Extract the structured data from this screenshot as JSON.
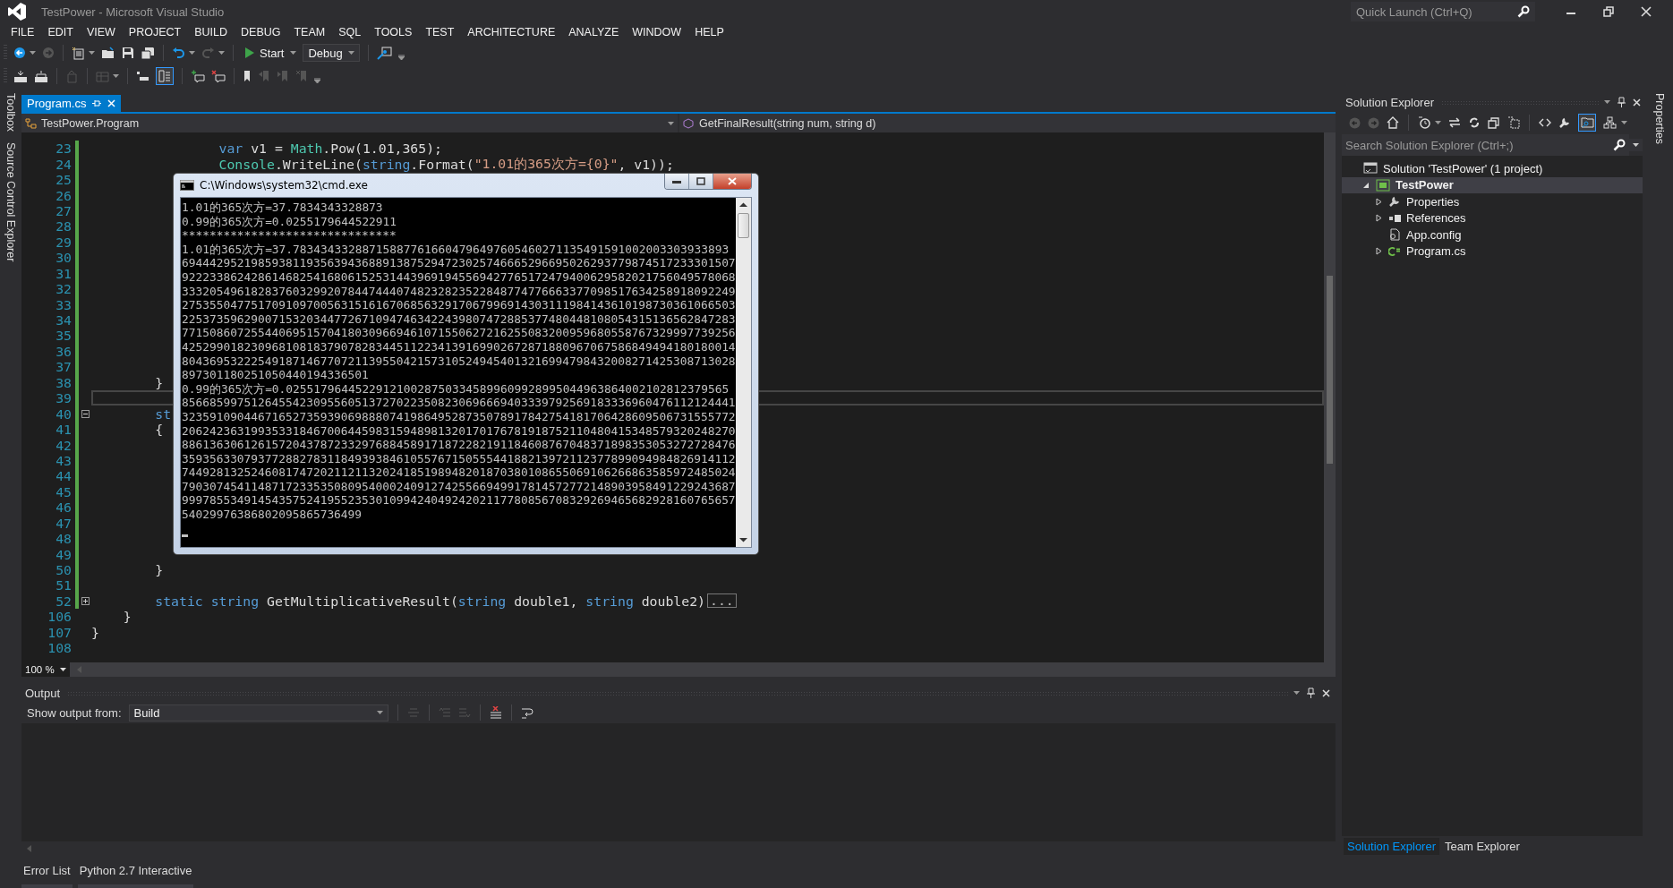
{
  "window": {
    "title": "TestPower - Microsoft Visual Studio",
    "quick_launch": {
      "placeholder": "Quick Launch (Ctrl+Q)"
    }
  },
  "menu": [
    "FILE",
    "EDIT",
    "VIEW",
    "PROJECT",
    "BUILD",
    "DEBUG",
    "TEAM",
    "SQL",
    "TOOLS",
    "TEST",
    "ARCHITECTURE",
    "ANALYZE",
    "WINDOW",
    "HELP"
  ],
  "toolbar": {
    "start_label": "Start",
    "configuration": "Debug",
    "toggle_on": true
  },
  "left_tabs": [
    "Toolbox",
    "Source Control Explorer"
  ],
  "document_tabs": [
    {
      "label": "Program.cs",
      "selected": true
    }
  ],
  "navigation": {
    "class": "TestPower.Program",
    "member": "GetFinalResult(string num, string d)"
  },
  "code_lines": [
    {
      "number": "23",
      "changed": true,
      "current": false,
      "tokens": [
        {
          "kind": "keyword",
          "text": "                var"
        },
        {
          "kind": "plain",
          "text": " v1 = "
        },
        {
          "kind": "type",
          "text": "Math"
        },
        {
          "kind": "plain",
          "text": ".Pow(1.01,365);"
        }
      ]
    },
    {
      "number": "24",
      "changed": true,
      "current": false,
      "tokens": [
        {
          "kind": "type",
          "text": "                Console"
        },
        {
          "kind": "plain",
          "text": ".WriteLine("
        },
        {
          "kind": "keyword",
          "text": "string"
        },
        {
          "kind": "plain",
          "text": ".Format("
        },
        {
          "kind": "string",
          "text": "\"1.01的365次方={0}\""
        },
        {
          "kind": "plain",
          "text": ", v1));"
        }
      ]
    },
    {
      "number": "25",
      "changed": true,
      "current": false
    },
    {
      "number": "26",
      "changed": true,
      "current": false
    },
    {
      "number": "27",
      "changed": true,
      "current": false
    },
    {
      "number": "28",
      "changed": true,
      "current": false
    },
    {
      "number": "29",
      "changed": true,
      "current": false
    },
    {
      "number": "30",
      "changed": true,
      "current": false
    },
    {
      "number": "31",
      "changed": true,
      "current": false
    },
    {
      "number": "32",
      "changed": true,
      "current": false
    },
    {
      "number": "33",
      "changed": true,
      "current": false
    },
    {
      "number": "34",
      "changed": true,
      "current": false
    },
    {
      "number": "35",
      "changed": true,
      "current": false
    },
    {
      "number": "36",
      "changed": true,
      "current": false
    },
    {
      "number": "37",
      "changed": true,
      "current": false
    },
    {
      "number": "38",
      "changed": true,
      "current": false,
      "tokens": [
        {
          "kind": "plain",
          "text": "        }"
        }
      ]
    },
    {
      "number": "39",
      "changed": true,
      "current": true
    },
    {
      "number": "40",
      "changed": true,
      "current": false,
      "folded": false,
      "tokens": [
        {
          "kind": "keyword",
          "text": "        st"
        }
      ]
    },
    {
      "number": "41",
      "changed": true,
      "current": false,
      "tokens": [
        {
          "kind": "plain",
          "text": "        {"
        }
      ]
    },
    {
      "number": "42",
      "changed": true,
      "current": false
    },
    {
      "number": "43",
      "changed": true,
      "current": false
    },
    {
      "number": "44",
      "changed": true,
      "current": false
    },
    {
      "number": "45",
      "changed": true,
      "current": false
    },
    {
      "number": "46",
      "changed": true,
      "current": false
    },
    {
      "number": "47",
      "changed": true,
      "current": false
    },
    {
      "number": "48",
      "changed": true,
      "current": false
    },
    {
      "number": "49",
      "changed": true,
      "current": false
    },
    {
      "number": "50",
      "changed": true,
      "current": false,
      "tokens": [
        {
          "kind": "plain",
          "text": "        }"
        }
      ]
    },
    {
      "number": "51",
      "changed": true,
      "current": false
    },
    {
      "number": "52",
      "changed": true,
      "current": false,
      "folded": true,
      "collapsed_text": "...",
      "tokens": [
        {
          "kind": "keyword",
          "text": "        static"
        },
        {
          "kind": "keyword",
          "text": " string"
        },
        {
          "kind": "plain",
          "text": " GetMultiplicativeResult("
        },
        {
          "kind": "keyword",
          "text": "string"
        },
        {
          "kind": "plain",
          "text": " double1, "
        },
        {
          "kind": "keyword",
          "text": "string"
        },
        {
          "kind": "plain",
          "text": " double2)"
        }
      ]
    },
    {
      "number": "106",
      "changed": false,
      "current": false,
      "tokens": [
        {
          "kind": "plain",
          "text": "    }"
        }
      ]
    },
    {
      "number": "107",
      "changed": false,
      "current": false,
      "tokens": [
        {
          "kind": "plain",
          "text": "}"
        }
      ]
    },
    {
      "number": "108",
      "changed": false,
      "current": false
    }
  ],
  "zoom": "100 %",
  "console": {
    "title": "C:\\Windows\\system32\\cmd.exe",
    "lines": [
      "1.01的365次方=37.7834343328873",
      "0.99的365次方=0.0255179644522911",
      "*******************************",
      "1.01的365次方=37.783434332887158877616604796497605460271135491591002003303933893",
      "69444295219859381193563943688913875294723025746665296695026293779874517233301507",
      "92223386242861468254168061525314439691945569427765172479400629582021756049578068",
      "33320549618283760329920784474440748232823522848774776663377098517634258918092249",
      "27535504775170910970056315161670685632917067996914303111984143610198730361066503",
      "22537359629007153203447726710947463422439807472885377480448108054315136562847283",
      "77150860725544069515704180309669461071550627216255083200959680558767329997739256",
      "42529901823096810818379078283445112234139169902672871880967067586849494180180014",
      "80436953222549187146770721139550421573105249454013216994798432008271425308713028",
      "897301180251050440194336501",
      "0.99的365次方=0.0255179644522912100287503345899609928995044963864002102812379565",
      "85668599751264554230955605137270223508230696669403339792569183336960476112124441",
      "32359109044671652735939069888074198649528735078917842754181706428609506731555772",
      "20624236319935331846700644598315948981320170176781918752110480415348579320248270",
      "88613630612615720437872332976884589171872282191184608767048371898353053272728476",
      "35935633079377288278311849393846105576715055544188213972112377899094984826914112",
      "74492813252460817472021121132024185198948201870380108655069106266863585972485024",
      "79030745411487172335350809540002409127425566949917814572772148903958491229243687",
      "99978553491454357524195523530109942404924202117780856708329269465682928160765657",
      "54029976386802095865736499"
    ]
  },
  "output": {
    "title": "Output",
    "show_from_label": "Show output from:",
    "source": "Build"
  },
  "bottom_tabs": [
    {
      "label": "Error List",
      "selected": false
    },
    {
      "label": "Python 2.7 Interactive",
      "selected": false
    }
  ],
  "solution_explorer": {
    "title": "Solution Explorer",
    "toggle_on": true,
    "search": {
      "placeholder": "Search Solution Explorer (Ctrl+;)"
    },
    "tree": [
      {
        "label": "Solution 'TestPower' (1 project)",
        "kind": "solution",
        "selected": false,
        "children": [
          {
            "label": "TestPower",
            "kind": "project",
            "expanded": true,
            "selected": true,
            "children": [
              {
                "label": "Properties",
                "kind": "properties",
                "expanded": false,
                "selected": false
              },
              {
                "label": "References",
                "kind": "references",
                "expanded": false,
                "selected": false
              },
              {
                "label": "App.config",
                "kind": "config",
                "selected": false
              },
              {
                "label": "Program.cs",
                "kind": "csharp",
                "expanded": false,
                "selected": false
              }
            ]
          }
        ]
      }
    ]
  },
  "right_tabs": [
    "Properties"
  ],
  "explorer_tabs": [
    {
      "label": "Solution Explorer",
      "selected": true
    },
    {
      "label": "Team Explorer",
      "selected": false
    }
  ]
}
